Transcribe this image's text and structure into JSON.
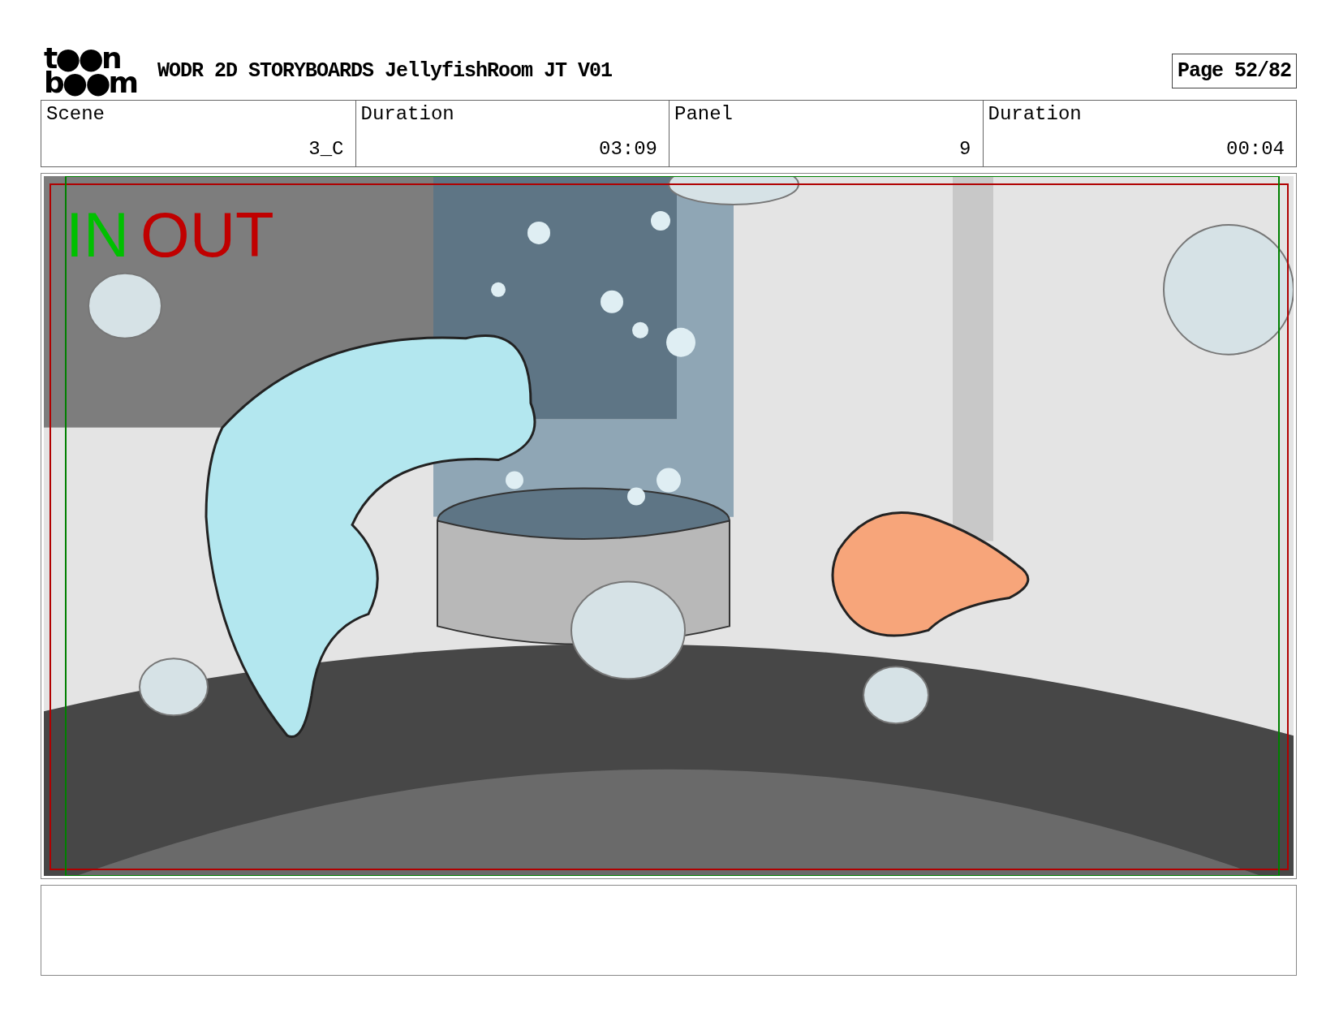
{
  "header": {
    "logo_lines": [
      "t●●n",
      "b●●m"
    ],
    "title": "WODR 2D STORYBOARDS JellyfishRoom JT V01",
    "page": "Page 52/82"
  },
  "fields": [
    {
      "label": "Scene",
      "value": "3_C"
    },
    {
      "label": "Duration",
      "value": "03:09"
    },
    {
      "label": "Panel",
      "value": "9"
    },
    {
      "label": "Duration",
      "value": "00:04"
    }
  ],
  "panel": {
    "marks": [
      {
        "text": "IN",
        "color": "#00c000"
      },
      {
        "text": "OUT",
        "color": "#c00000"
      }
    ]
  }
}
